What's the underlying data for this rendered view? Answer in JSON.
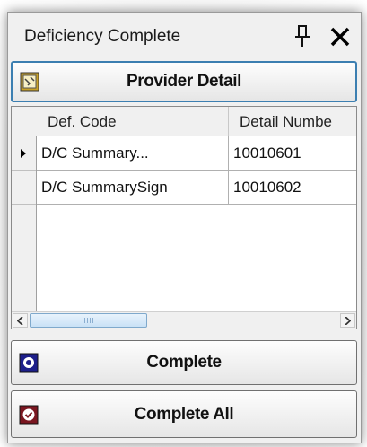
{
  "window": {
    "title": "Deficiency Complete"
  },
  "buttons": {
    "provider_detail": "Provider Detail",
    "complete": "Complete",
    "complete_all": "Complete All"
  },
  "grid": {
    "columns": [
      "Def. Code",
      "Detail Numbe"
    ],
    "rows": [
      {
        "def_code": "D/C Summary...",
        "detail_number": "10010601",
        "selected": true
      },
      {
        "def_code": "D/C SummarySign",
        "detail_number": "10010602",
        "selected": false
      }
    ]
  },
  "icons": {
    "pin": "pin-icon",
    "close": "close-icon",
    "provider": "provider-detail-icon",
    "complete": "complete-icon",
    "complete_all": "complete-all-icon"
  },
  "colors": {
    "provider_border": "#3c7fb1",
    "complete_icon_bg": "#1d1f8a",
    "complete_all_icon_bg": "#7a1620",
    "provider_icon_bg": "#c9a227"
  }
}
